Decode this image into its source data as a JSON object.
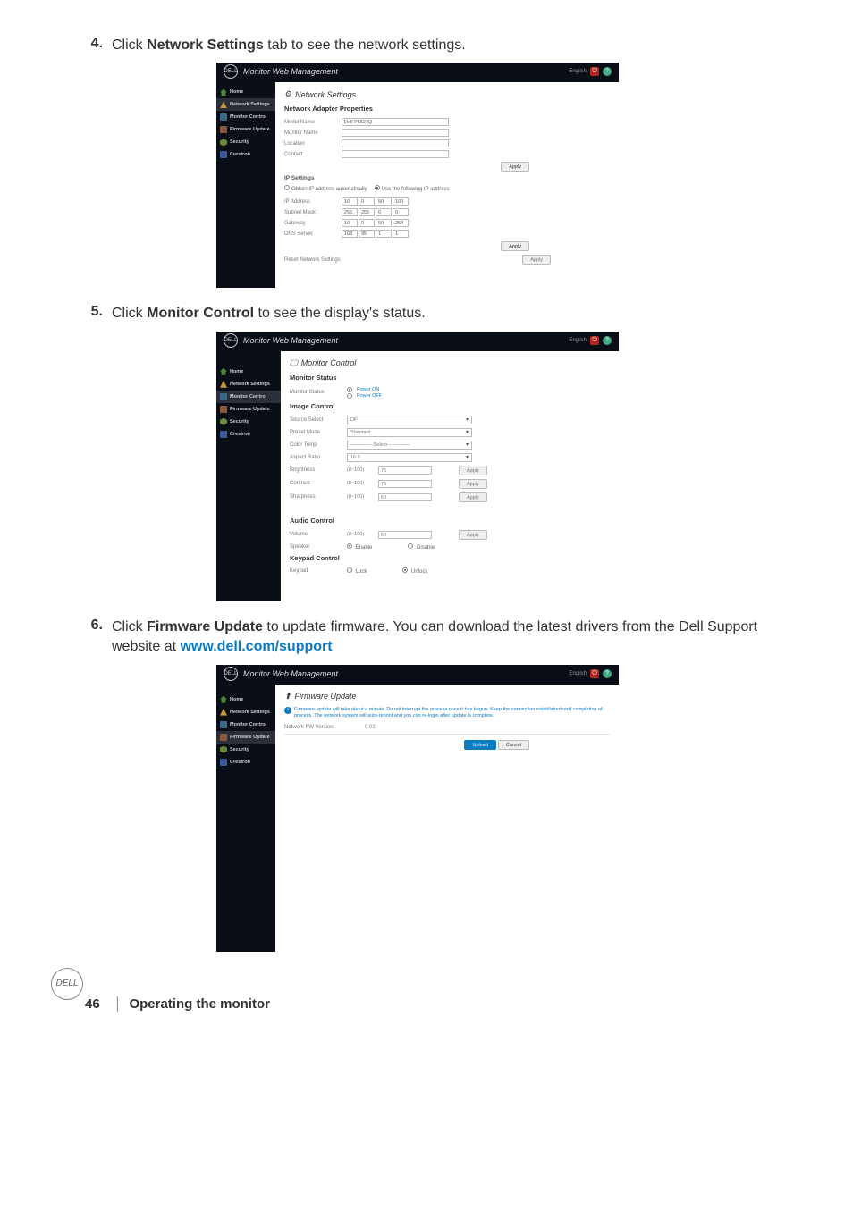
{
  "steps": {
    "s4": {
      "num": "4.",
      "pre": "Click ",
      "bold": "Network Settings",
      "post": " tab to see the network settings."
    },
    "s5": {
      "num": "5.",
      "pre": "Click ",
      "bold": "Monitor Control",
      "post": " to see the display's status."
    },
    "s6": {
      "num": "6.",
      "pre": "Click ",
      "bold": "Firmware Update",
      "post": " to update firmware. You can download the latest drivers from the Dell Support website at ",
      "link": "www.dell.com/support"
    }
  },
  "common": {
    "brand": "DELL",
    "app_title": "Monitor Web Management",
    "lang": "English",
    "nav": {
      "home": "Home",
      "network": "Network Settings",
      "monitor": "Monitor Control",
      "firmware": "Firmware Update",
      "security": "Security",
      "crestron": "Crestron"
    },
    "apply": "Apply",
    "upload": "Upload",
    "cancel": "Cancel"
  },
  "shot1": {
    "title": "Network Settings",
    "adapter_props": "Network Adapter Properties",
    "model_name_lbl": "Model Name",
    "model_name_val": "Dell P5524Q",
    "monitor_name_lbl": "Monitor Name",
    "location_lbl": "Location",
    "contact_lbl": "Contact",
    "ip_settings": "IP Settings",
    "obtain_auto": "Obtain IP address automatically",
    "use_following": "Use the following IP address",
    "ip_address_lbl": "IP Address",
    "ip": [
      "10",
      "0",
      "50",
      "100"
    ],
    "subnet_lbl": "Subnet Mask",
    "subnet": [
      "255",
      "255",
      "0",
      "0"
    ],
    "gateway_lbl": "Gateway",
    "gateway": [
      "10",
      "0",
      "50",
      "254"
    ],
    "dns_lbl": "DNS Server",
    "dns": [
      "168",
      "95",
      "1",
      "1"
    ],
    "reset_lbl": "Reset Network Settings"
  },
  "shot2": {
    "title": "Monitor Control",
    "monitor_status_h": "Monitor Status",
    "monitor_status_lbl": "Monitor Status",
    "power_on": "Power ON",
    "power_off": "Power OFF",
    "image_control_h": "Image Control",
    "source_select_lbl": "Source Select",
    "source_select_val": "DP",
    "preset_mode_lbl": "Preset Mode",
    "preset_mode_val": "Standard",
    "color_temp_lbl": "Color Temp",
    "color_temp_val": "--------------Select--------------",
    "aspect_ratio_lbl": "Aspect Ratio",
    "aspect_ratio_val": "16:9",
    "brightness_lbl": "Brightness",
    "brightness_val": "75",
    "contrast_lbl": "Contrast",
    "contrast_val": "75",
    "sharpness_lbl": "Sharpness",
    "sharpness_val": "50",
    "range_0_100": "(0~100)",
    "audio_control_h": "Audio Control",
    "volume_lbl": "Volume",
    "volume_val": "50",
    "speaker_lbl": "Speaker",
    "enable": "Enable",
    "disable": "Disable",
    "keypad_control_h": "Keypad Control",
    "keypad_lbl": "Keypad",
    "lock": "Lock",
    "unlock": "Unlock"
  },
  "shot3": {
    "title": "Firmware Update",
    "info": "Firmware update will take about a minute. Do not interrupt the process once it has begun. Keep the connection established until completion of process. The network system will auto-reboot and you can re-login after update is complete.",
    "fw_version_lbl": "Network FW Version",
    "fw_version_val": "0.01"
  },
  "footer": {
    "logo": "DELL",
    "page": "46",
    "section": "Operating the monitor"
  }
}
